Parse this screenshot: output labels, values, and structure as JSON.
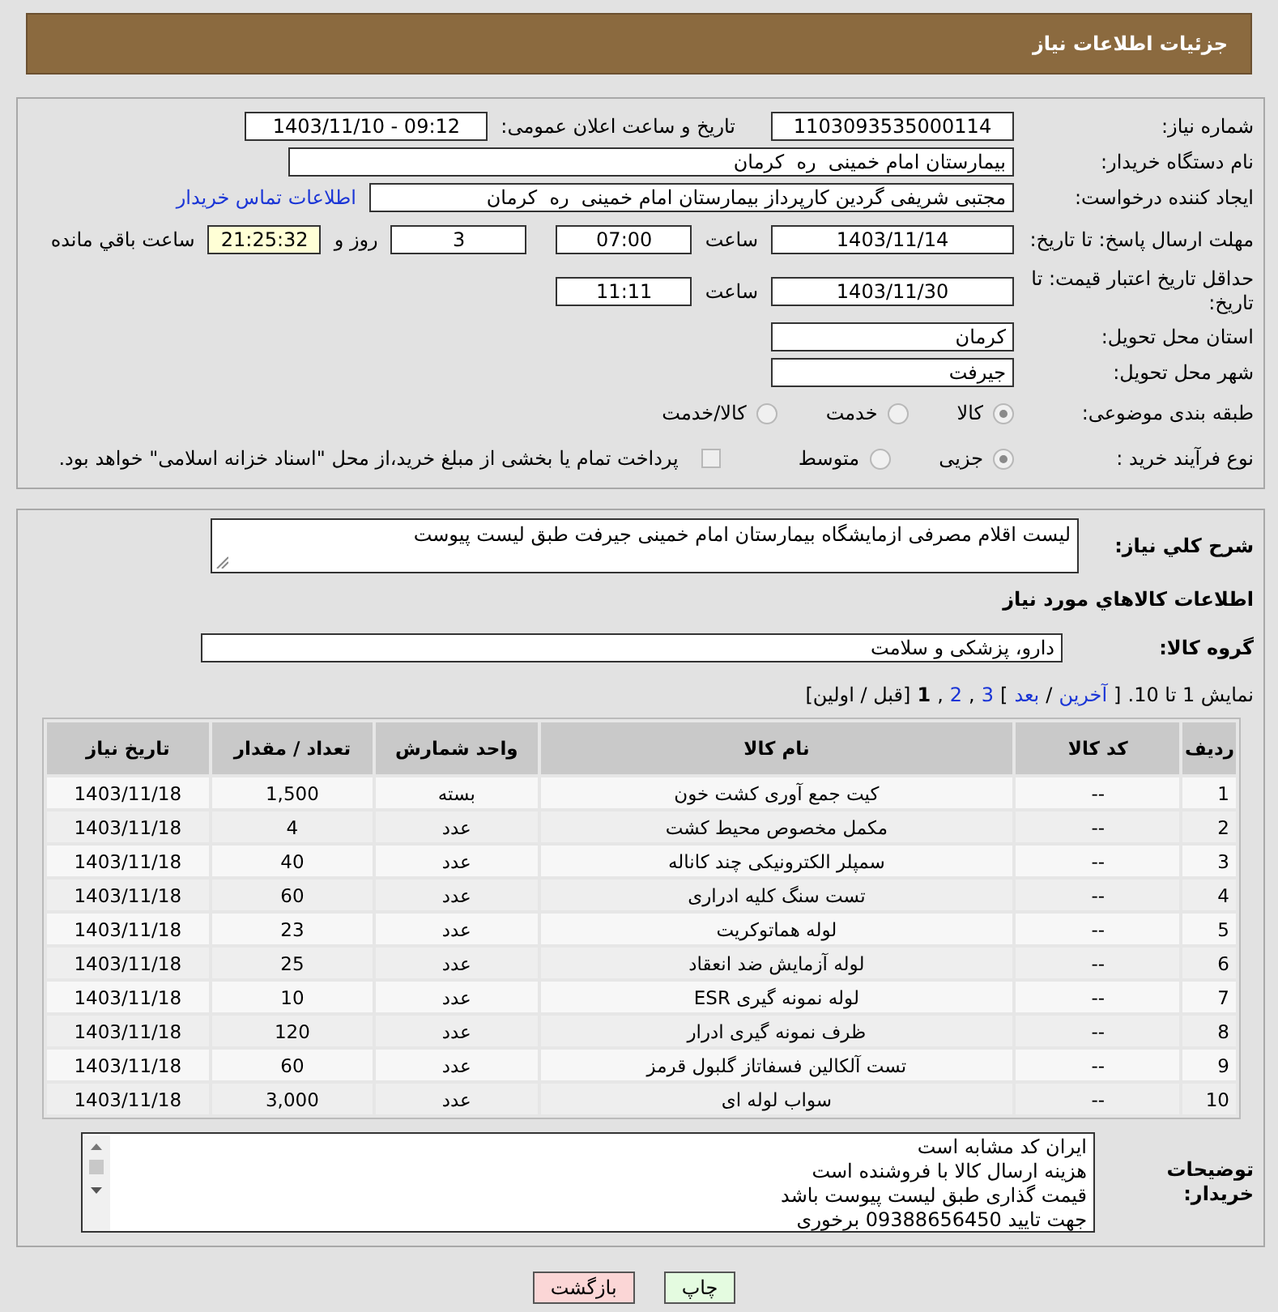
{
  "page_title": "جزئیات اطلاعات نیاز",
  "need_number": {
    "label": "شماره نیاز:",
    "value": "1103093535000114"
  },
  "announce": {
    "label": "تاریخ و ساعت اعلان عمومی:",
    "value": "1403/11/10 - 09:12"
  },
  "buyer_org": {
    "label": "نام دستگاه خریدار:",
    "value": "بیمارستان امام خمینی  ره  کرمان"
  },
  "requester": {
    "label": "ایجاد کننده درخواست:",
    "value": "مجتبی شریفی گردین کارپرداز بیمارستان امام خمینی  ره  کرمان",
    "link": "اطلاعات تماس خریدار"
  },
  "reply_deadline": {
    "label": "مهلت ارسال پاسخ: تا تاریخ:",
    "date": "1403/11/14",
    "time_label": "ساعت",
    "time": "07:00",
    "days": "3",
    "days_label": "روز و",
    "remaining": "21:25:32",
    "remaining_label": "ساعت باقي مانده"
  },
  "price_validity": {
    "label": "حداقل تاریخ اعتبار قیمت: تا تاریخ:",
    "date": "1403/11/30",
    "time_label": "ساعت",
    "time": "11:11"
  },
  "province": {
    "label": "استان محل تحویل:",
    "value": "کرمان"
  },
  "city": {
    "label": "شهر محل تحویل:",
    "value": "جیرفت"
  },
  "category": {
    "label": "طبقه بندی موضوعی:",
    "options": [
      {
        "label": "کالا",
        "selected": true
      },
      {
        "label": "خدمت",
        "selected": false
      },
      {
        "label": "کالا/خدمت",
        "selected": false
      }
    ]
  },
  "purchase_type": {
    "label": "نوع فرآیند خرید :",
    "options": [
      {
        "label": "جزیی",
        "selected": true
      },
      {
        "label": "متوسط",
        "selected": false
      }
    ],
    "payment": {
      "checked": false,
      "text": "پرداخت تمام يا بخشی از مبلغ خرید،از محل \"اسناد خزانه اسلامی\" خواهد بود."
    }
  },
  "description": {
    "label": "شرح کلي نياز:",
    "value": "لیست اقلام مصرفی ازمایشگاه بیمارستان امام خمینی جیرفت طبق لیست پیوست"
  },
  "items_title": "اطلاعات کالاهاي مورد نياز",
  "group": {
    "label": "گروه کالا:",
    "value": "دارو، پزشکی و سلامت"
  },
  "pagination": [
    {
      "kind": "plain",
      "text": "نمایش 1 تا 10."
    },
    {
      "kind": "plain",
      "text": "["
    },
    {
      "kind": "link",
      "text": "آخرین"
    },
    {
      "kind": "plain",
      "text": "/"
    },
    {
      "kind": "link",
      "text": "بعد"
    },
    {
      "kind": "plain",
      "text": "]"
    },
    {
      "kind": "link",
      "text": "3"
    },
    {
      "kind": "plain",
      "text": ","
    },
    {
      "kind": "link",
      "text": "2"
    },
    {
      "kind": "plain",
      "text": ","
    },
    {
      "kind": "current",
      "text": "1"
    },
    {
      "kind": "plain",
      "text": "[قبل / اولین]"
    }
  ],
  "table": {
    "columns": [
      "ردیف",
      "کد کالا",
      "نام کالا",
      "واحد شمارش",
      "تعداد / مقدار",
      "تاریخ نیاز"
    ],
    "rows": [
      [
        "1",
        "--",
        "کیت جمع آوری کشت خون",
        "بسته",
        "1,500",
        "1403/11/18"
      ],
      [
        "2",
        "--",
        "مکمل مخصوص محیط کشت",
        "عدد",
        "4",
        "1403/11/18"
      ],
      [
        "3",
        "--",
        "سمپلر الکترونیکی چند کاناله",
        "عدد",
        "40",
        "1403/11/18"
      ],
      [
        "4",
        "--",
        "تست سنگ کلیه ادراری",
        "عدد",
        "60",
        "1403/11/18"
      ],
      [
        "5",
        "--",
        "لوله هماتوکریت",
        "عدد",
        "23",
        "1403/11/18"
      ],
      [
        "6",
        "--",
        "لوله آزمایش ضد انعقاد",
        "عدد",
        "25",
        "1403/11/18"
      ],
      [
        "7",
        "--",
        "لوله نمونه گیری ESR",
        "عدد",
        "10",
        "1403/11/18"
      ],
      [
        "8",
        "--",
        "ظرف نمونه گیری ادرار",
        "عدد",
        "120",
        "1403/11/18"
      ],
      [
        "9",
        "--",
        "تست آلکالین فسفاتاز گلبول قرمز",
        "عدد",
        "60",
        "1403/11/18"
      ],
      [
        "10",
        "--",
        "سواب لوله ای",
        "عدد",
        "3,000",
        "1403/11/18"
      ]
    ]
  },
  "buyer_notes": {
    "label": "توضیحات خریدار:",
    "lines": [
      "ایران کد مشابه است",
      "هزینه ارسال کالا با فروشنده است",
      "قیمت گذاری طبق لیست پیوست باشد",
      "جهت تایید 09388656450 برخوری"
    ]
  },
  "buttons": [
    {
      "kind": "print",
      "label": "چاپ"
    },
    {
      "kind": "back",
      "label": "بازگشت"
    }
  ]
}
